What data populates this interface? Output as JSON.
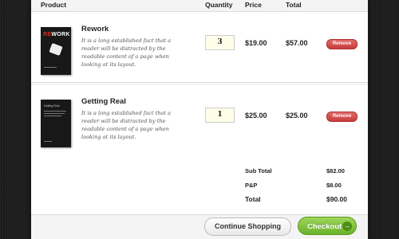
{
  "columns": {
    "product": "Product",
    "quantity": "Quantity",
    "price": "Price",
    "total": "Total"
  },
  "items": [
    {
      "name": "Rework",
      "cover_title_left": "RE",
      "cover_title_right": "WORK",
      "description": "It is a long established fact that a reader will be distracted by the readable content of a page when looking at its layout.",
      "quantity": "3",
      "price": "$19.00",
      "total": "$57.00",
      "remove_label": "Remove"
    },
    {
      "name": "Getting Real",
      "cover_small": "Getting Real",
      "description": "It is a long established fact that a reader will be distracted by the readable content of a page when looking at its layout.",
      "quantity": "1",
      "price": "$25.00",
      "total": "$25.00",
      "remove_label": "Remove"
    }
  ],
  "summary": {
    "subtotal_label": "Sub Total",
    "subtotal_value": "$82.00",
    "pp_label": "P&P",
    "pp_value": "$8.00",
    "total_label": "Total",
    "total_value": "$90.00"
  },
  "buttons": {
    "continue_label": "Continue Shopping",
    "checkout_label": "Checkout",
    "checkout_arrow": "→"
  },
  "colors": {
    "checkout": "#6bb22b",
    "remove": "#c53d3d",
    "background": "#222222"
  }
}
